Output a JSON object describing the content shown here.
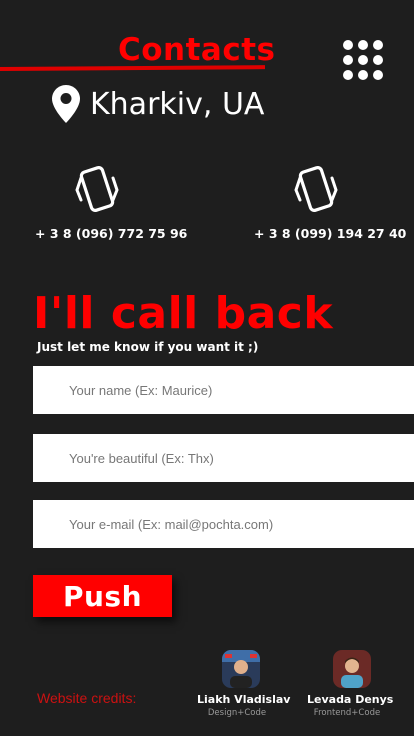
{
  "header": {
    "title": "Contacts",
    "location": "Kharkiv, UA",
    "accent_color": "#ff0000"
  },
  "menu": {
    "icon": "grid-menu-icon"
  },
  "phones": [
    {
      "icon": "vibrating-phone-icon",
      "number": "+ 3 8 (096) 772 75 96"
    },
    {
      "icon": "vibrating-phone-icon",
      "number": "+ 3 8 (099) 194 27 40"
    }
  ],
  "callback": {
    "heading": "I'll call back",
    "subheading": "Just let me know if you want it ;)",
    "fields": [
      {
        "placeholder": "Your name (Ex: Maurice)"
      },
      {
        "placeholder": "You're beautiful (Ex: Thx)"
      },
      {
        "placeholder": "Your e-mail (Ex: mail@pochta.com)"
      }
    ],
    "submit_label": "Push"
  },
  "credits": {
    "label": "Website credits:",
    "people": [
      {
        "name": "Liakh Vladislav",
        "role": "Design+Code"
      },
      {
        "name": "Levada Denys",
        "role": "Frontend+Code"
      }
    ]
  }
}
